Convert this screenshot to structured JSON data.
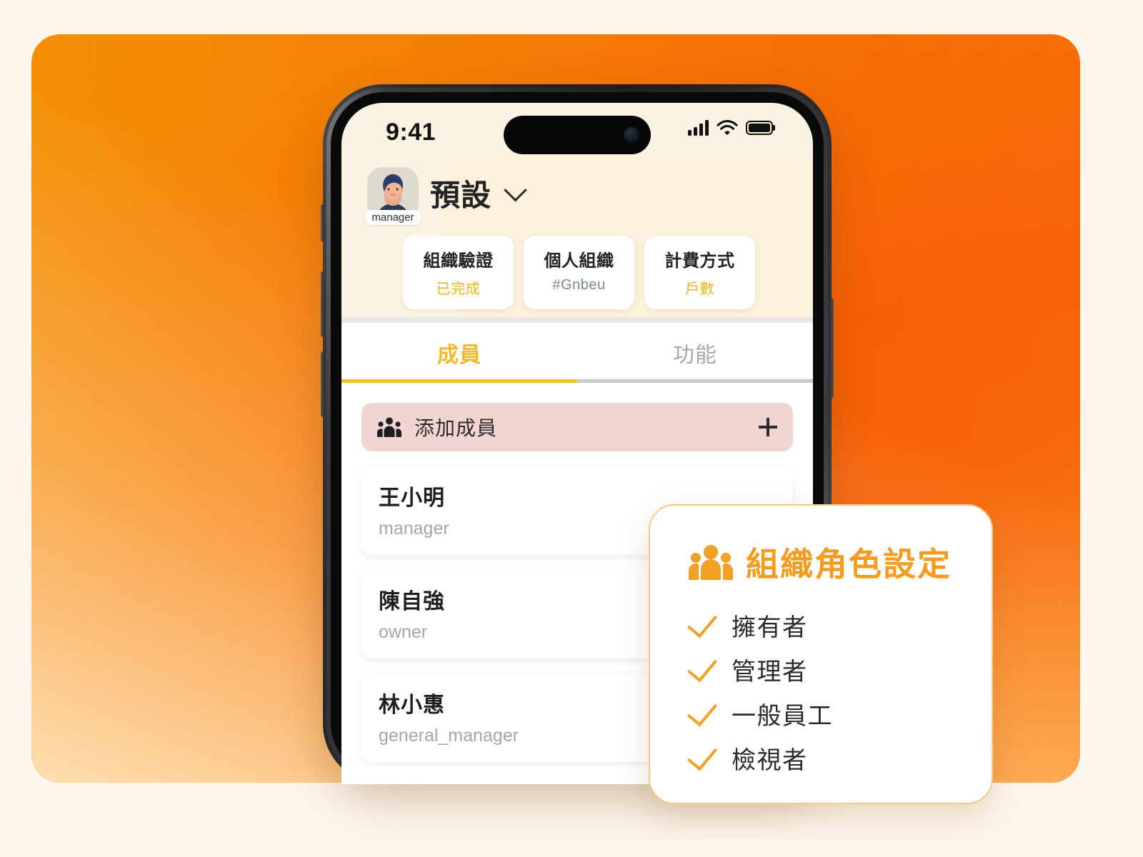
{
  "statusbar": {
    "time": "9:41",
    "signal_icon": "cellular-bars-icon",
    "wifi_icon": "wifi-icon",
    "battery_icon": "battery-full-icon"
  },
  "header": {
    "avatar_badge": "manager",
    "org_name": "預設",
    "dropdown_icon": "chevron-down-icon",
    "info_cards": [
      {
        "title": "組織驗證",
        "value": "已完成",
        "value_style": "gold"
      },
      {
        "title": "個人組織",
        "value": "#Gnbeu",
        "value_style": "grey"
      },
      {
        "title": "計費方式",
        "value": "戶數",
        "value_style": "gold"
      }
    ]
  },
  "tabs": [
    {
      "label": "成員",
      "active": true
    },
    {
      "label": "功能",
      "active": false
    }
  ],
  "members_panel": {
    "add_member": {
      "label": "添加成員",
      "icon": "group-people-icon",
      "action_icon": "plus-icon"
    },
    "members": [
      {
        "name": "王小明",
        "role": "manager"
      },
      {
        "name": "陳自強",
        "role": "owner"
      },
      {
        "name": "林小惠",
        "role": "general_manager"
      }
    ]
  },
  "role_card": {
    "icon": "group-people-icon",
    "title": "組織角色設定",
    "items": [
      {
        "label": "擁有者",
        "icon": "check-icon"
      },
      {
        "label": "管理者",
        "icon": "check-icon"
      },
      {
        "label": "一般員工",
        "icon": "check-icon"
      },
      {
        "label": "檢視者",
        "icon": "check-icon"
      }
    ]
  },
  "colors": {
    "page_background": "#FDF6EC",
    "panel_gradient_start": "#F9C022",
    "panel_gradient_end": "#FB9A26",
    "accent_gold": "#F0B92A",
    "accent_orange": "#F39C1F",
    "screen_cream": "#FBF3E2",
    "add_member_pink": "#F2D5D2",
    "tab_underline_active": "#F5C224",
    "tab_underline_inactive": "#C9C9C9"
  }
}
